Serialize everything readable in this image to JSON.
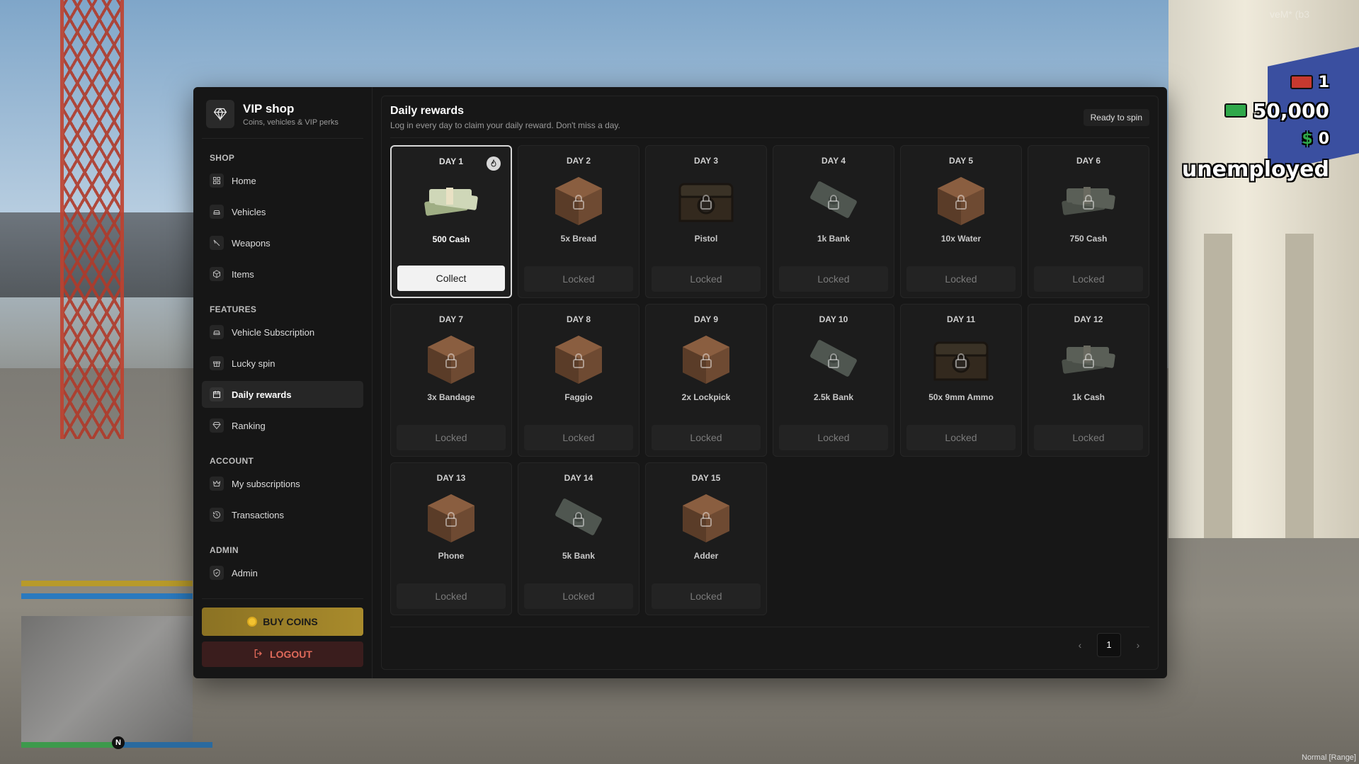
{
  "hud": {
    "wanted": "1",
    "cash": "50,000",
    "bank": "0",
    "bank_symbol": "$",
    "job": "unemployed",
    "corner_text": "Normal [Range]",
    "top_right_text": "veM* (b3",
    "compass": "N"
  },
  "brand": {
    "title": "VIP shop",
    "subtitle": "Coins, vehicles & VIP perks"
  },
  "sidebar": {
    "shop_title": "SHOP",
    "shop_items": [
      {
        "label": "Home",
        "icon": "home-grid-icon"
      },
      {
        "label": "Vehicles",
        "icon": "car-icon"
      },
      {
        "label": "Weapons",
        "icon": "knife-icon"
      },
      {
        "label": "Items",
        "icon": "box-icon"
      }
    ],
    "features_title": "FEATURES",
    "feature_items": [
      {
        "label": "Vehicle Subscription",
        "icon": "car-icon"
      },
      {
        "label": "Lucky spin",
        "icon": "gift-icon"
      },
      {
        "label": "Daily rewards",
        "icon": "calendar-icon"
      },
      {
        "label": "Ranking",
        "icon": "diamond-icon"
      }
    ],
    "account_title": "ACCOUNT",
    "account_items": [
      {
        "label": "My subscriptions",
        "icon": "crown-icon"
      },
      {
        "label": "Transactions",
        "icon": "history-icon"
      }
    ],
    "admin_title": "ADMIN",
    "admin_items": [
      {
        "label": "Admin",
        "icon": "shield-icon"
      }
    ],
    "buy_coins": "BUY COINS",
    "logout": "LOGOUT"
  },
  "main": {
    "title": "Daily rewards",
    "subtitle": "Log in every day to claim your daily reward. Don't miss a day.",
    "badge": "Ready to spin",
    "page": "1",
    "colors": {
      "accent_gold": "#a98b2c",
      "logout_red": "#e06a5a"
    },
    "rewards": [
      {
        "day": "DAY 1",
        "name": "500 Cash",
        "type": "cash",
        "button": "Collect"
      },
      {
        "day": "DAY 2",
        "name": "5x Bread",
        "type": "box",
        "button": "Locked"
      },
      {
        "day": "DAY 3",
        "name": "Pistol",
        "type": "chest",
        "button": "Locked"
      },
      {
        "day": "DAY 4",
        "name": "1k Bank",
        "type": "bill",
        "button": "Locked"
      },
      {
        "day": "DAY 5",
        "name": "10x Water",
        "type": "box",
        "button": "Locked"
      },
      {
        "day": "DAY 6",
        "name": "750 Cash",
        "type": "cash",
        "button": "Locked"
      },
      {
        "day": "DAY 7",
        "name": "3x Bandage",
        "type": "box",
        "button": "Locked"
      },
      {
        "day": "DAY 8",
        "name": "Faggio",
        "type": "box",
        "button": "Locked"
      },
      {
        "day": "DAY 9",
        "name": "2x Lockpick",
        "type": "box",
        "button": "Locked"
      },
      {
        "day": "DAY 10",
        "name": "2.5k Bank",
        "type": "bill",
        "button": "Locked"
      },
      {
        "day": "DAY 11",
        "name": "50x 9mm Ammo",
        "type": "chest",
        "button": "Locked"
      },
      {
        "day": "DAY 12",
        "name": "1k Cash",
        "type": "cash",
        "button": "Locked"
      },
      {
        "day": "DAY 13",
        "name": "Phone",
        "type": "box",
        "button": "Locked"
      },
      {
        "day": "DAY 14",
        "name": "5k Bank",
        "type": "bill",
        "button": "Locked"
      },
      {
        "day": "DAY 15",
        "name": "Adder",
        "type": "box",
        "button": "Locked"
      }
    ]
  }
}
